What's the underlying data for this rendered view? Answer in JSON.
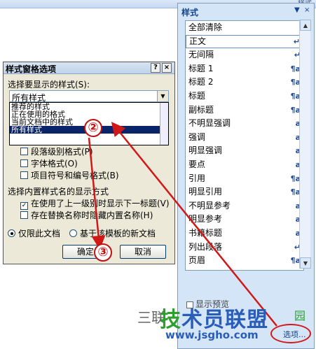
{
  "ribbon": {
    "label": "样式"
  },
  "styles_pane": {
    "title": "样式",
    "dropdown_glyph": "▼",
    "close_glyph": "×",
    "items": [
      {
        "label": "全部清除",
        "mark": ""
      },
      {
        "label": "正文",
        "mark": "↵"
      },
      {
        "label": "无间隔",
        "mark": "↵"
      },
      {
        "label": "标题 1",
        "mark": "¶a"
      },
      {
        "label": "标题 2",
        "mark": "¶a"
      },
      {
        "label": "标题",
        "mark": "¶a"
      },
      {
        "label": "副标题",
        "mark": "¶a"
      },
      {
        "label": "不明显强调",
        "mark": "a"
      },
      {
        "label": "强调",
        "mark": "a"
      },
      {
        "label": "明显强调",
        "mark": "a"
      },
      {
        "label": "要点",
        "mark": "a"
      },
      {
        "label": "引用",
        "mark": "¶a"
      },
      {
        "label": "明显引用",
        "mark": "¶a"
      },
      {
        "label": "不明显参考",
        "mark": "a"
      },
      {
        "label": "明显参考",
        "mark": "a"
      },
      {
        "label": "书籍标题",
        "mark": "a"
      },
      {
        "label": "列出段落",
        "mark": "↵"
      },
      {
        "label": "页眉",
        "mark": "¶a"
      }
    ],
    "show_preview_label": "显示预览",
    "options_link": "选项..."
  },
  "dialog": {
    "title": "样式窗格选项",
    "help_glyph": "?",
    "close_glyph": "×",
    "select_label": "选择要显示的样式(S):",
    "select_value": "所有样式",
    "options": [
      "推荐的样式",
      "正在使用的格式",
      "当前文档中的样式",
      "所有样式"
    ],
    "checks": [
      {
        "label": "段落级别格式(P)",
        "checked": false
      },
      {
        "label": "字体格式(O)",
        "checked": false
      },
      {
        "label": "项目符号和编号格式(B)",
        "checked": false
      }
    ],
    "builtin_label": "选择内置样式名的显示方式",
    "builtin_checks": [
      {
        "label": "在使用了上一级别时显示下一标题(V)",
        "checked": true
      },
      {
        "label": "存在替换名称时隐藏内置名称(H)",
        "checked": false
      }
    ],
    "radios": [
      {
        "label": "仅限此文档",
        "selected": true
      },
      {
        "label": "基于该模板的新文档",
        "selected": false
      }
    ],
    "ok": "确定",
    "cancel": "取消"
  },
  "annotations": {
    "badge2": "②",
    "badge3": "③"
  },
  "watermark": {
    "text": "三联",
    "logo_a": "技",
    "logo_b": "术员联盟",
    "garden": "园",
    "url": "www.jsgho.com"
  }
}
